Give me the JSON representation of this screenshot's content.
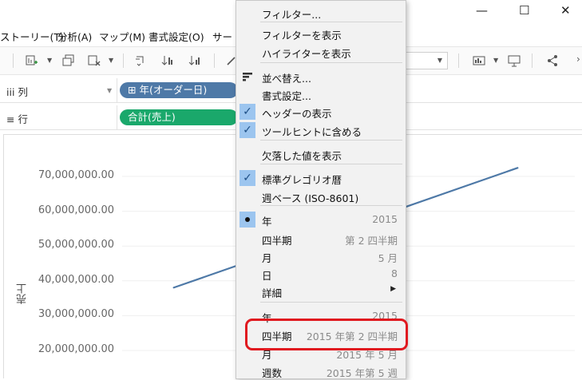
{
  "window": {
    "minimize_glyph": "—",
    "maximize_glyph": "☐",
    "close_glyph": "✕"
  },
  "menubar": {
    "items": [
      "ストーリー(T)",
      "分析(A)",
      "マップ(M)",
      "書式設定(O)",
      "サー"
    ]
  },
  "shelves": {
    "columns": {
      "label": "iii 列",
      "pill": "⊞ 年(オーダー日)",
      "pill_color": "#4e79a7"
    },
    "rows": {
      "label": "≡ 行",
      "pill": "合計(売上)",
      "pill_color": "#1aa86b"
    }
  },
  "chart_data": {
    "type": "line",
    "ylabel": "売上",
    "y_ticks": [
      "70,000,000.00",
      "60,000,000.00",
      "50,000,000.00",
      "40,000,000.00",
      "30,000,000.00",
      "20,000,000.00"
    ],
    "y_tick_values": [
      70000000,
      60000000,
      50000000,
      40000000,
      30000000,
      20000000
    ],
    "ylim": [
      15000000,
      72500000
    ],
    "series": [
      {
        "values": [
          38000000,
          72500000
        ],
        "color": "#4e79a7"
      }
    ]
  },
  "context_menu": {
    "items": [
      {
        "label": "フィルター..."
      },
      {
        "label": "フィルターを表示"
      },
      {
        "label": "ハイライターを表示"
      },
      {
        "label": "並べ替え..."
      },
      {
        "label": "書式設定..."
      },
      {
        "label": "ヘッダーの表示",
        "checked": true
      },
      {
        "label": "ツールヒントに含める",
        "checked": true
      },
      {
        "label": "欠落した値を表示"
      },
      {
        "label": "標準グレゴリオ暦",
        "checked": true
      },
      {
        "label": "週ベース (ISO-8601)"
      },
      {
        "label": "年",
        "value": "2015",
        "selected": true
      },
      {
        "label": "四半期",
        "value": "第 2 四半期"
      },
      {
        "label": "月",
        "value": "5 月"
      },
      {
        "label": "日",
        "value": "8"
      },
      {
        "label": "詳細"
      },
      {
        "label": "年",
        "value": "2015"
      },
      {
        "label": "四半期",
        "value": "2015 年第 2 四半期"
      },
      {
        "label": "月",
        "value": "2015 年 5 月"
      },
      {
        "label": "週数",
        "value": "2015 年第 5 週"
      }
    ]
  },
  "colors": {
    "highlight": "#e0191f",
    "menu_check_bg": "#9cc5ef"
  }
}
